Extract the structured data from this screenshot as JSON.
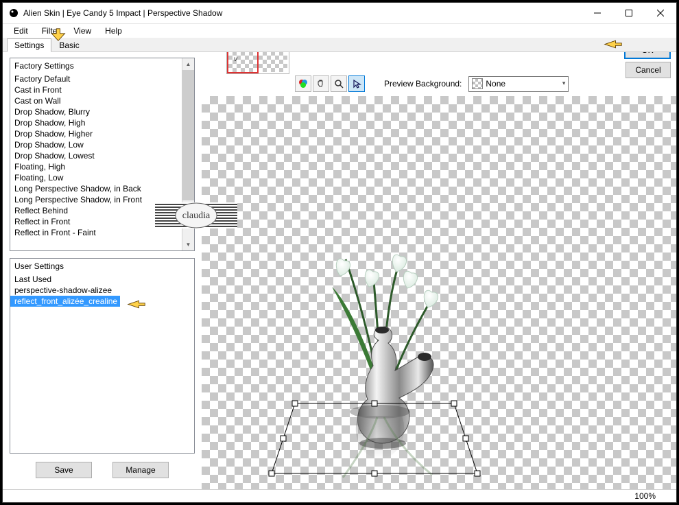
{
  "window": {
    "title": "Alien Skin | Eye Candy 5 Impact | Perspective Shadow"
  },
  "menu": {
    "edit": "Edit",
    "filter": "Filter",
    "view": "View",
    "help": "Help"
  },
  "tabs": {
    "settings": "Settings",
    "basic": "Basic"
  },
  "factory": {
    "header": "Factory Settings",
    "items": [
      "Factory Default",
      "Cast in Front",
      "Cast on Wall",
      "Drop Shadow, Blurry",
      "Drop Shadow, High",
      "Drop Shadow, Higher",
      "Drop Shadow, Low",
      "Drop Shadow, Lowest",
      "Floating, High",
      "Floating, Low",
      "Long Perspective Shadow, in Back",
      "Long Perspective Shadow, in Front",
      "Reflect Behind",
      "Reflect in Front",
      "Reflect in Front - Faint"
    ]
  },
  "user": {
    "header": "User Settings",
    "items": [
      "Last Used",
      "perspective-shadow-alizee",
      "reflect_front_alizée_crealine"
    ],
    "selected_index": 2
  },
  "buttons": {
    "save": "Save",
    "manage": "Manage",
    "ok": "OK",
    "cancel": "Cancel"
  },
  "preview": {
    "bg_label": "Preview Background:",
    "bg_selected": "None"
  },
  "status": {
    "zoom": "100%"
  },
  "watermark_text": "claudia"
}
